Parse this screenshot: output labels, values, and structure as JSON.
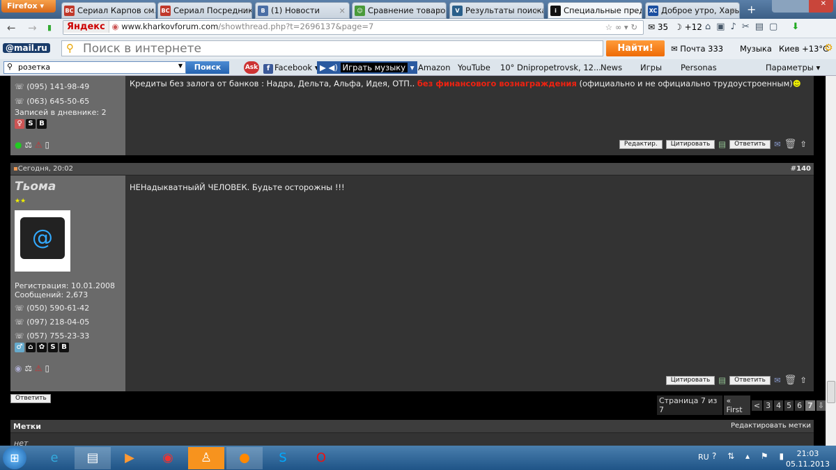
{
  "browser": {
    "menu": "Firefox",
    "tabs": [
      {
        "label": "Сериал Карпов см...",
        "fav": "ВС",
        "color": "#c0392b"
      },
      {
        "label": "Сериал Посредник...",
        "fav": "ВС",
        "color": "#c0392b"
      },
      {
        "label": "(1) Новости",
        "fav": "В",
        "color": "#4a6ea5"
      },
      {
        "label": "Сравнение товаров...",
        "fav": "☺",
        "color": "#4a9a3a"
      },
      {
        "label": "Результаты поиска ...",
        "fav": "V",
        "color": "#2a5f8a"
      },
      {
        "label": "Специальные пред...",
        "fav": "i",
        "color": "#111"
      },
      {
        "label": "Доброе утро, Харь...",
        "fav": "XC",
        "color": "#1b4fa0"
      }
    ],
    "new_tab": "+",
    "yandex": "Яндекс",
    "url_domain": "www.kharkovforum.com",
    "url_path": "/showthread.php?t=2696137&page=7",
    "mail_count": "35",
    "weather_small": "+12"
  },
  "mailru": {
    "logo": "@mail.ru",
    "search_placeholder": "Поиск в интернете",
    "find": "Найти!",
    "mail": "Почта 333",
    "music": "Музыка",
    "weather": "Киев +13°C"
  },
  "bookmarks": {
    "search_value": "розетка",
    "search_btn": "Поиск",
    "items": [
      "Facebook",
      "Играть музыку",
      "Amazon",
      "YouTube",
      "10° Dnipropetrovsk, 12...",
      "News",
      "Игры",
      "Personas"
    ],
    "params": "Параметры"
  },
  "post1": {
    "phones": [
      "(095) 141-98-49",
      "(063) 645-50-65"
    ],
    "diary_label": "Записей в дневнике:",
    "diary_count": "2",
    "text_link": "Кредиты без залога от банков : Надра, Дельта, Альфа, Идея, ОТП..",
    "text_red": "без финансового вознаграждения",
    "text_tail": "(официально и не официально трудоустроенным)",
    "buttons": [
      "Редактир.",
      "Цитировать",
      "Ответить"
    ]
  },
  "post2": {
    "date": "Сегодня, 20:02",
    "number_prefix": "#",
    "number": "140",
    "user": "Тьома",
    "reg": "Регистрация: 10.01.2008",
    "msgs": "Сообщений: 2,673",
    "phones": [
      "(050) 590-61-42",
      "(097) 218-04-05",
      "(057) 755-23-33"
    ],
    "text": "НЕНадыкватныйЙ ЧЕЛОВЕК. Будьте осторожны !!!",
    "buttons": [
      "Цитировать",
      "Ответить"
    ]
  },
  "reply": "Ответить",
  "pagination": {
    "label": "Страница 7 из 7",
    "first": "« First",
    "prev": "<",
    "pages": [
      "3",
      "4",
      "5",
      "6",
      "7"
    ],
    "current": "7"
  },
  "tags": {
    "title": "Метки",
    "edit": "Редактировать метки",
    "value": "нет"
  },
  "tray": {
    "lang": "RU",
    "time": "21:03",
    "date": "05.11.2013"
  }
}
